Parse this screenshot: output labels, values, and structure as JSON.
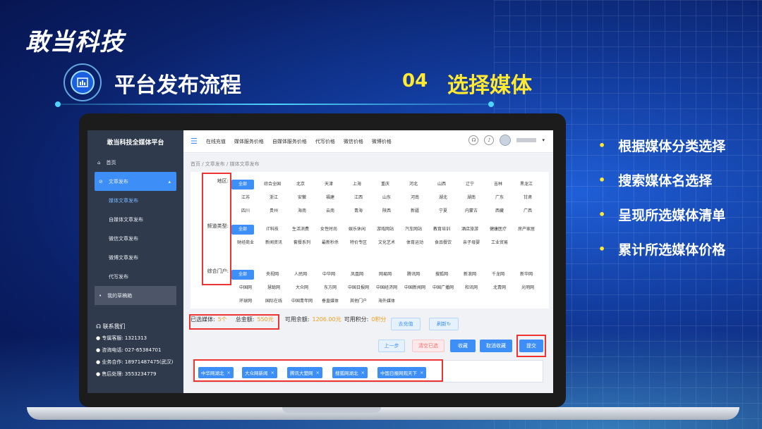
{
  "brand": {
    "logo": "敢当科技"
  },
  "slide": {
    "title": "平台发布流程",
    "step_number": "04",
    "step_name": "选择媒体"
  },
  "bullets": [
    "根据媒体分类选择",
    "搜索媒体名选择",
    "呈现所选媒体清单",
    "累计所选媒体价格"
  ],
  "app": {
    "sidebar_title": "敢当科技全媒体平台",
    "menu": [
      "首页",
      "文章发布",
      "媒体文章发布",
      "自媒体文章发布",
      "微信文章发布",
      "微博文章发布",
      "代写发布",
      "我的草稿箱"
    ],
    "contact": {
      "title": "联系我们",
      "lines": [
        "专属客服: 1321313",
        "咨询电话: 027-65384701",
        "业务合作: 18971487475(武汉)",
        "售后处理: 3553234779"
      ]
    },
    "topnav": [
      "在线充值",
      "媒体服务价格",
      "自媒体服务价格",
      "代写价格",
      "微信价格",
      "微博价格"
    ],
    "breadcrumb": "首页  /  文章发布  /  媒体文章发布",
    "filters": {
      "region_label": "地区:",
      "region": [
        "全部",
        "综合全国",
        "北京",
        "天津",
        "上海",
        "重庆",
        "河北",
        "山西",
        "辽宁",
        "吉林",
        "黑龙江",
        "江苏",
        "浙江",
        "安徽",
        "福建",
        "江西",
        "山东",
        "河南",
        "湖北",
        "湖南",
        "广东",
        "甘肃",
        "四川",
        "贵州",
        "海南",
        "云南",
        "青海",
        "陕西",
        "新疆",
        "宁夏",
        "内蒙古",
        "西藏",
        "广西"
      ],
      "channel_label": "频道类型:",
      "channel": [
        "全部",
        "IT科技",
        "生活消费",
        "女性时尚",
        "娱乐休闲",
        "游戏网站",
        "汽车网站",
        "教育培训",
        "酒店旅游",
        "健康医疗",
        "房产家居",
        "财经商业",
        "新闻资讯",
        "套餐系列",
        "最新秒杀",
        "特价专区",
        "文化艺术",
        "体育运动",
        "食品餐饮",
        "亲子母婴",
        "工业贸易"
      ],
      "portal_label": "综合门户:",
      "portal": [
        "全部",
        "央视网",
        "人民网",
        "中华网",
        "凤凰网",
        "网易网",
        "腾讯网",
        "搜狐网",
        "新浪网",
        "千龙网",
        "新华网",
        "中国网",
        "慧聪网",
        "大众网",
        "东方网",
        "中国日报网",
        "中国经济网",
        "中国新闻网",
        "中国广播网",
        "和讯网",
        "北青网",
        "光明网",
        "环球网",
        "国际在线",
        "中国青年网",
        "垂直媒体",
        "其他门户",
        "海外媒体"
      ]
    },
    "summary": {
      "selected_label": "已选媒体:",
      "selected_value": "5个",
      "total_label": "总金额:",
      "total_value": "550元",
      "balance_label": "可用余额:",
      "balance_value": "1206.00元",
      "points_label": "可用积分:",
      "points_value": "0积分",
      "recharge": "去充值",
      "refresh": "刷新"
    },
    "actions": {
      "prev": "上一步",
      "clear": "清空已选",
      "favorite": "收藏",
      "unfavorite": "取消收藏",
      "submit": "提交"
    },
    "selected_media": [
      "中华网湖北",
      "大众网新闻",
      "腾讯大楚网",
      "搜狐网湖北",
      "中国日报网观天下"
    ]
  }
}
